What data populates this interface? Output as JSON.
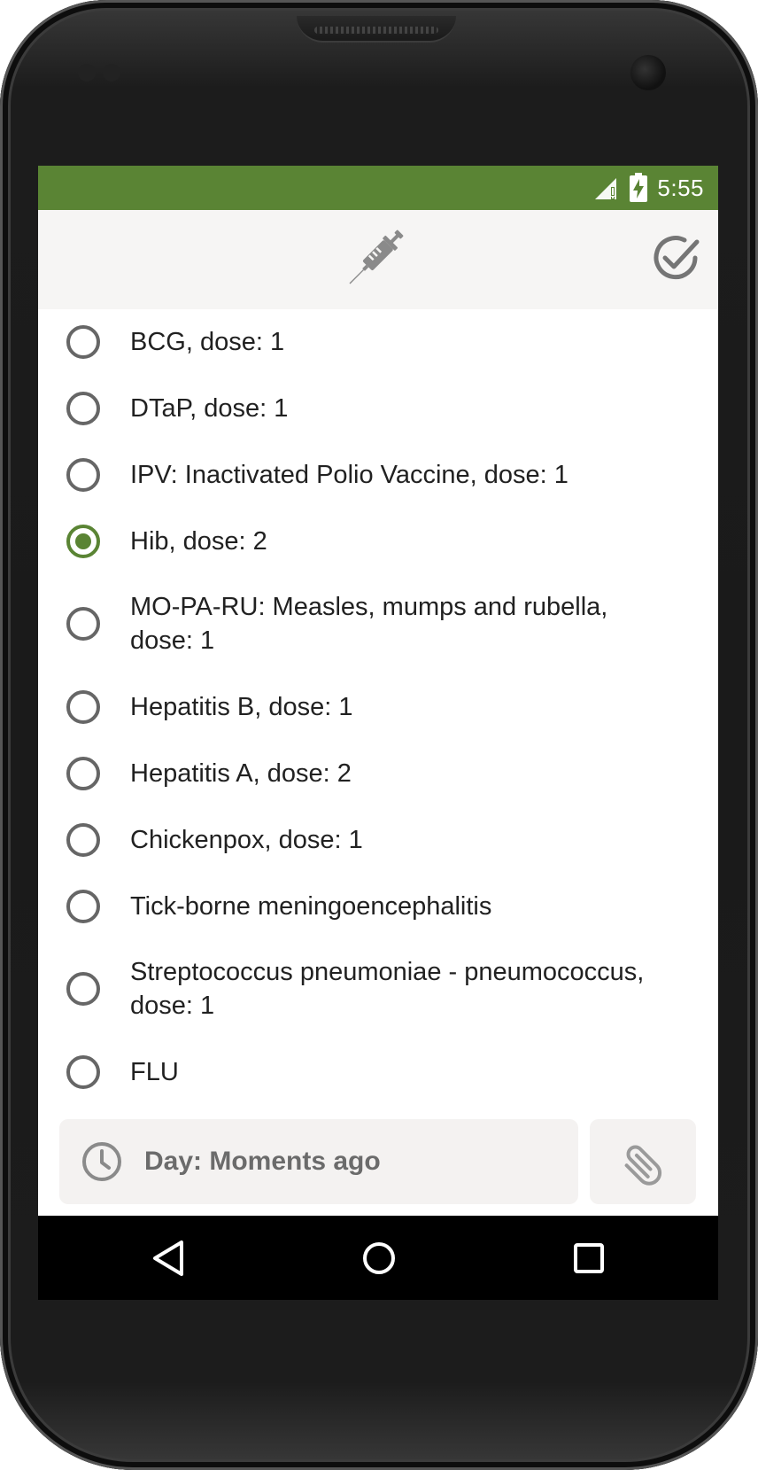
{
  "status_bar": {
    "time": "5:55",
    "color": "#5a8434"
  },
  "toolbar": {
    "center_icon": "syringe-icon",
    "action_icon": "check-circle-icon"
  },
  "vaccines": [
    {
      "label": "BCG, dose: 1",
      "selected": false
    },
    {
      "label": "DTaP, dose: 1",
      "selected": false
    },
    {
      "label": "IPV: Inactivated Polio Vaccine, dose: 1",
      "selected": false
    },
    {
      "label": "Hib, dose: 2",
      "selected": true
    },
    {
      "label": "MO-PA-RU: Measles, mumps and rubella, dose: 1",
      "selected": false
    },
    {
      "label": "Hepatitis B, dose: 1",
      "selected": false
    },
    {
      "label": "Hepatitis A, dose: 2",
      "selected": false
    },
    {
      "label": "Chickenpox, dose: 1",
      "selected": false
    },
    {
      "label": "Tick-borne meningoencephalitis",
      "selected": false
    },
    {
      "label": "Streptococcus pneumoniae - pneumococcus, dose: 1",
      "selected": false
    },
    {
      "label": "FLU",
      "selected": false
    }
  ],
  "date_field": {
    "text": "Day: Moments ago",
    "icon": "clock-icon"
  },
  "attach_button": {
    "icon": "paperclip-icon"
  },
  "nav_bar": {
    "buttons": [
      "back-icon",
      "home-icon",
      "recents-icon"
    ]
  },
  "colors": {
    "accent": "#5a8434",
    "toolbar_bg": "#f6f5f4",
    "text": "#212121",
    "icon_gray": "#757575"
  }
}
